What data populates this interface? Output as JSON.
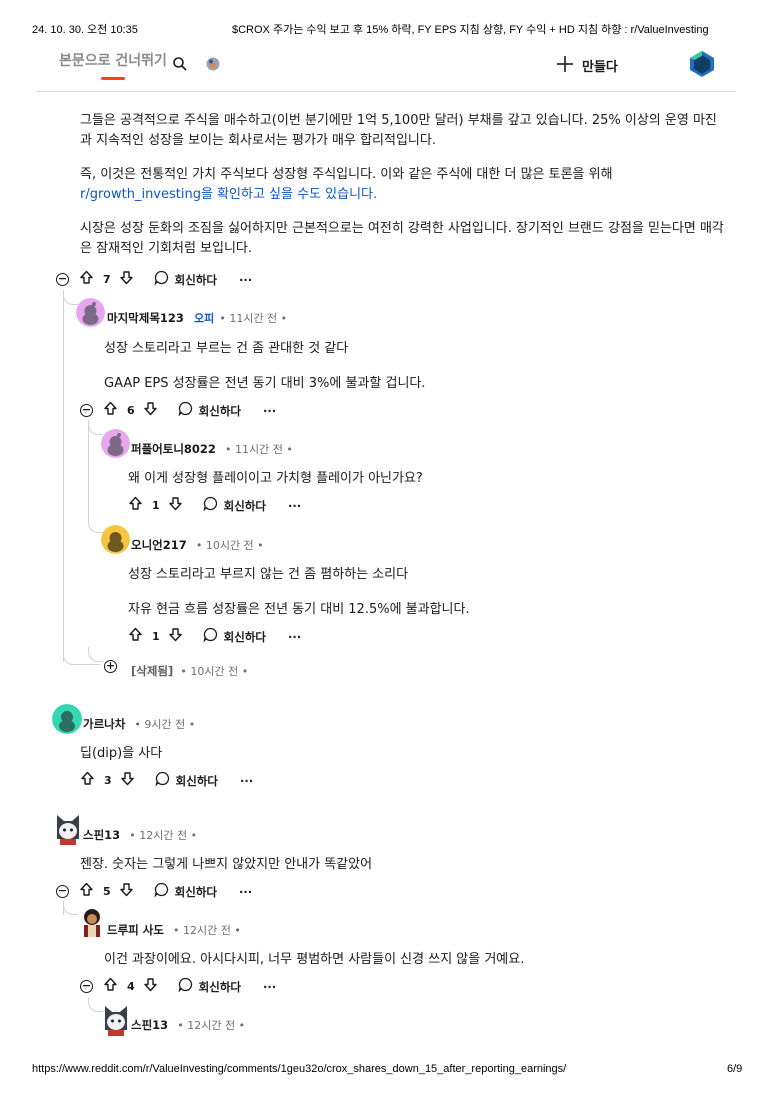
{
  "print_header": {
    "datetime": "24. 10. 30. 오전 10:35",
    "page_title": "$CROX 주가는 수익 보고 후 15% 하락, FY EPS 지침 상향, FY 수익 + HD 지침 하향 : r/ValueInvesting"
  },
  "print_footer": {
    "url": "https://www.reddit.com/r/ValueInvesting/comments/1geu32o/crox_shares_down_15_after_reporting_earnings/",
    "page_num": "6/9"
  },
  "header": {
    "skip_link": "본문으로 건너뛰기",
    "create_label": "만들다",
    "accent": "#ff4500"
  },
  "post_body": {
    "p1": "그들은 공격적으로 주식을 매수하고(이번 분기에만 1억 5,100만 달러) 부채를 갚고 있습니다. 25% 이상의 운영 마진과 지속적인 성장을 보이는 회사로서는 평가가 매우 합리적입니다.",
    "p2_text": "즉, 이것은 전통적인 가치 주식보다 성장형 주식입니다. 이와 같은 주식에 대한 더 많은 토론을 위해",
    "p2_link": "r/growth_investing을 확인하고 싶을 수도 있습니다.",
    "p3": "시장은 성장 둔화의 조짐을 싫어하지만 근본적으로는 여전히 강력한 사업입니다. 장기적인 브랜드 강점을 믿는다면 매각은 잠재적인 기회처럼 보입니다."
  },
  "actions": {
    "reply_label": "회신하다",
    "more_label": "···"
  },
  "votes": {
    "c0": "7",
    "c1": "6",
    "c2": "1",
    "c3": "1",
    "c5": "3",
    "c6": "5",
    "c7": "4"
  },
  "comments": {
    "c1": {
      "user": "마지막제목123",
      "op_badge": "오피",
      "time": "• 11시간 전 •",
      "line1": "성장 스토리라고 부르는 건 좀 관대한 것 같다",
      "line2": "GAAP EPS 성장률은 전년 동기 대비 3%에 불과할 겁니다."
    },
    "c2": {
      "user": "퍼플어토니8022",
      "time": "• 11시간 전 •",
      "line1": "왜 이게 성장형 플레이이고 가치형 플레이가 아닌가요?"
    },
    "c3": {
      "user": "오니언217",
      "time": "• 10시간 전 •",
      "line1": "성장 스토리라고 부르지 않는 건 좀 폄하하는 소리다",
      "line2": "자유 현금 흐름 성장률은 전년 동기 대비 12.5%에 불과합니다."
    },
    "c4": {
      "user": "[삭제됨]",
      "time": "• 10시간 전 •"
    },
    "c5": {
      "user": "가르나차",
      "time": "• 9시간 전 •",
      "line1": "딥(dip)을 사다"
    },
    "c6": {
      "user": "스핀13",
      "time": "• 12시간 전 •",
      "line1": "젠장. 숫자는 그렇게 나쁘지 않았지만 안내가 똑같았어"
    },
    "c7": {
      "user": "드루피 사도",
      "time": "• 12시간 전 •",
      "line1": "이건 과장이에요. 아시다시피, 너무 평범하면 사람들이 신경 쓰지 않을 거예요."
    },
    "c8": {
      "user": "스핀13",
      "time": "• 12시간 전 •"
    }
  }
}
